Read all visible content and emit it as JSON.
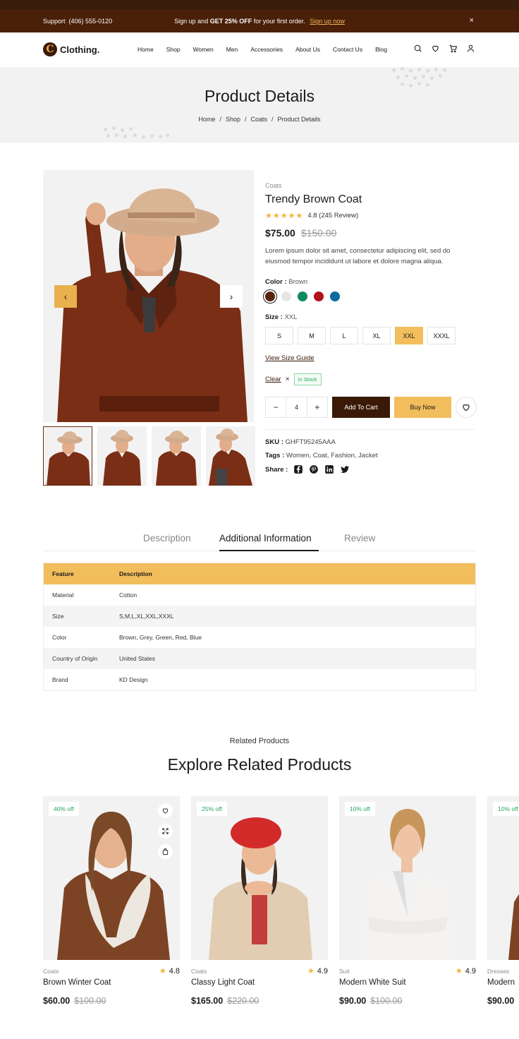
{
  "announcement": {
    "support_label": "Support",
    "support_phone": "(406) 555-0120",
    "promo_prefix": "Sign up and",
    "promo_bold": "GET 25% OFF",
    "promo_suffix": "for your first order.",
    "promo_link": "Sign up now",
    "close_glyph": "×"
  },
  "nav": {
    "logo_letter": "C",
    "logo_text": "Clothing.",
    "menu": [
      "Home",
      "Shop",
      "Women",
      "Men",
      "Accessories",
      "About Us",
      "Contact Us",
      "Blog"
    ],
    "icons": [
      "search-icon",
      "heart-icon",
      "cart-icon",
      "user-icon"
    ]
  },
  "hero": {
    "title": "Product Details",
    "breadcrumbs": [
      "Home",
      "Shop",
      "Coats",
      "Product Details"
    ],
    "separator": "/"
  },
  "gallery": {
    "prev_glyph": "‹",
    "next_glyph": "›",
    "thumb_count": 4
  },
  "product": {
    "category": "Coats",
    "name": "Trendy Brown Coat",
    "stars": "★★★★★",
    "rating_text": "4.8 (245 Review)",
    "rating": 4.8,
    "price": "$75.00",
    "old_price": "$150.00",
    "description": "Lorem ipsum dolor sit amet, consectetur adipiscing elit, sed do eiusmod tempor incididunt ut labore et dolore magna aliqua.",
    "color_label": "Color :",
    "color_value": "Brown",
    "colors": [
      "#5a2410",
      "#e6e6e6",
      "#0f8a5f",
      "#b3121a",
      "#0f6aa0"
    ],
    "size_label": "Size :",
    "size_value": "XXL",
    "sizes": [
      "S",
      "M",
      "L",
      "XL",
      "XXL",
      "XXXL"
    ],
    "selected_size": "XXL",
    "size_guide": "View Size Guide",
    "clear_label": "Clear",
    "clear_glyph": "×",
    "stock": "In Stock",
    "qty_minus": "−",
    "qty_value": "4",
    "qty_plus": "+",
    "add_to_cart": "Add To Cart",
    "buy_now": "Buy Now",
    "sku_label": "SKU :",
    "sku_value": "GHFT95245AAA",
    "tags_label": "Tags :",
    "tags_value": "Women, Coat, Fashion, Jacket",
    "share_label": "Share :",
    "share_icons": [
      "facebook-icon",
      "pinterest-icon",
      "linkedin-icon",
      "twitter-icon"
    ]
  },
  "tabs": {
    "items": [
      "Description",
      "Additional Information",
      "Review"
    ],
    "active": "Additional Information"
  },
  "spec_table": {
    "headers": [
      "Feature",
      "Description"
    ],
    "rows": [
      [
        "Material",
        "Cotton"
      ],
      [
        "Size",
        "S,M,L,XL,XXL,XXXL"
      ],
      [
        "Color",
        "Brown, Grey, Green, Red, Blue"
      ],
      [
        "Country of Origin",
        "United States"
      ],
      [
        "Brand",
        "KD Design"
      ]
    ]
  },
  "related": {
    "subtitle": "Related Products",
    "title": "Explore Related Products",
    "products": [
      {
        "badge": "40% off",
        "category": "Coats",
        "rating": "4.8",
        "name": "Brown Winter Coat",
        "price": "$60.00",
        "old_price": "$100.00"
      },
      {
        "badge": "25% off",
        "category": "Coats",
        "rating": "4.9",
        "name": "Classy Light Coat",
        "price": "$165.00",
        "old_price": "$220.00"
      },
      {
        "badge": "10% off",
        "category": "Suit",
        "rating": "4.9",
        "name": "Modern White Suit",
        "price": "$90.00",
        "old_price": "$100.00"
      },
      {
        "badge": "10% off",
        "category": "Dresses",
        "rating": "",
        "name": "Modern",
        "price": "$90.00",
        "old_price": ""
      }
    ]
  }
}
